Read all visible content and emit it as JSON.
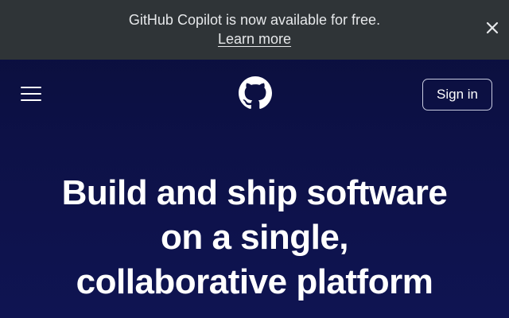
{
  "banner": {
    "message": "GitHub Copilot is now available for free.",
    "link_label": "Learn more",
    "close_icon": "close-icon"
  },
  "header": {
    "menu_icon": "hamburger-menu-icon",
    "logo_icon": "github-logo-icon",
    "signin_label": "Sign in"
  },
  "hero": {
    "lines": [
      "Build and ship software",
      "on a single,",
      "collaborative platform"
    ]
  },
  "colors": {
    "banner_bg": "#2f3437",
    "page_bg": "#0d1147",
    "text": "#ffffff"
  }
}
